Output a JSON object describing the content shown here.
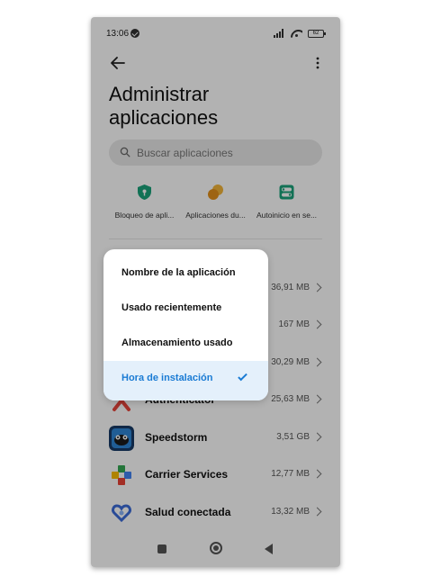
{
  "status_bar": {
    "time": "13:06",
    "battery": "62"
  },
  "header": {
    "title": "Administrar aplicaciones",
    "back_icon": "back-arrow-icon",
    "more_icon": "more-vertical-icon"
  },
  "search": {
    "placeholder": "Buscar aplicaciones"
  },
  "quick_actions": [
    {
      "label": "Bloqueo de apli...",
      "icon": "shield-lock-icon",
      "color": "#1aa37a"
    },
    {
      "label": "Aplicaciones du...",
      "icon": "dual-apps-icon",
      "color": "#f0a020"
    },
    {
      "label": "Autoinicio en se...",
      "icon": "autostart-toggle-icon",
      "color": "#1aa37a"
    }
  ],
  "apps": [
    {
      "name": "",
      "size": "36,91 MB"
    },
    {
      "name": "",
      "size": "167 MB"
    },
    {
      "name": "",
      "size": "30,29 MB"
    },
    {
      "name": "Authenticator",
      "size": "25,63 MB"
    },
    {
      "name": "Speedstorm",
      "size": "3,51 GB"
    },
    {
      "name": "Carrier Services",
      "size": "12,77 MB"
    },
    {
      "name": "Salud conectada",
      "size": "13,32 MB"
    }
  ],
  "sort_menu": {
    "options": [
      {
        "label": "Nombre de la aplicación",
        "selected": false
      },
      {
        "label": "Usado recientemente",
        "selected": false
      },
      {
        "label": "Almacenamiento usado",
        "selected": false
      },
      {
        "label": "Hora de instalación",
        "selected": true
      }
    ],
    "accent_color": "#1a7bd4"
  }
}
